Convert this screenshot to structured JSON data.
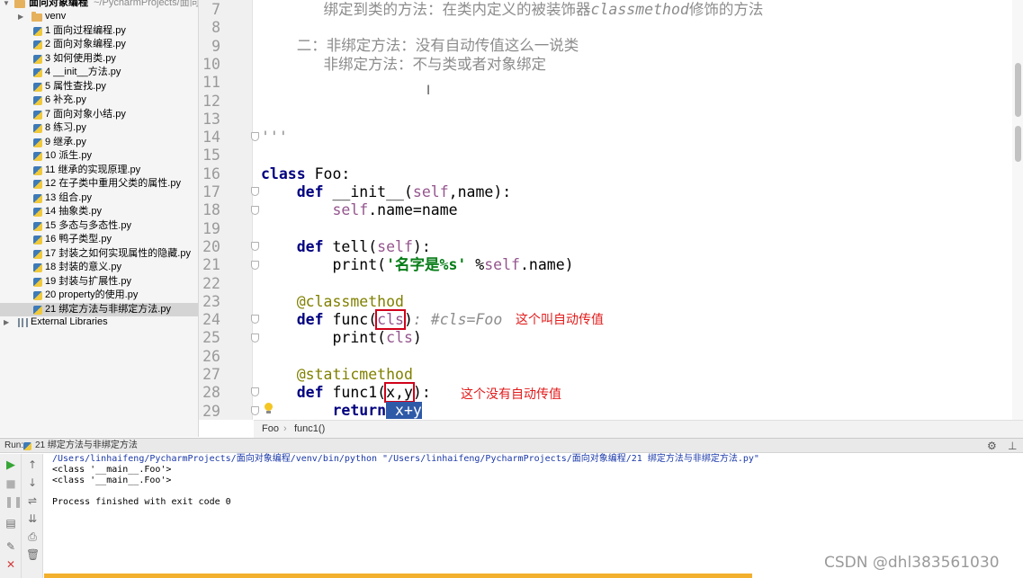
{
  "project": {
    "root_label": "面向对象编程",
    "root_path": "~/PycharmProjects/面向",
    "folder": "venv",
    "files": [
      "1 面向过程编程.py",
      "2 面向对象编程.py",
      "3 如何使用类.py",
      "4 __init__方法.py",
      "5 属性查找.py",
      "6 补充.py",
      "7 面向对象小结.py",
      "8 练习.py",
      "9 继承.py",
      "10 派生.py",
      "11 继承的实现原理.py",
      "12 在子类中重用父类的属性.py",
      "13 组合.py",
      "14 抽象类.py",
      "15 多态与多态性.py",
      "16 鸭子类型.py",
      "17 封装之如何实现属性的隐藏.py",
      "18 封装的意义.py",
      "19 封装与扩展性.py",
      "20 property的使用.py",
      "21 绑定方法与非绑定方法.py"
    ],
    "external_libraries": "External Libraries"
  },
  "editor": {
    "line_numbers": [
      "7",
      "8",
      "9",
      "10",
      "11",
      "12",
      "13",
      "14",
      "15",
      "16",
      "17",
      "18",
      "19",
      "20",
      "21",
      "22",
      "23",
      "24",
      "25",
      "26",
      "27",
      "28",
      "29"
    ],
    "line7": {
      "prefix": "       绑定到类的方法：在类内定义的被装饰器",
      "italic": "classmethod",
      "suffix": "修饰的方法"
    },
    "line9": "    二：非绑定方法：没有自动传值这么一说类",
    "line10": "       非绑定方法：不与类或者对象绑定",
    "line14": "'''",
    "line16": {
      "kw": "class",
      "rest": " Foo:"
    },
    "line17": {
      "kw": "def",
      "name": " __init__(",
      "self": "self",
      "rest": ",name):"
    },
    "line18": {
      "self": "self",
      "rest": ".name=name"
    },
    "line20": {
      "kw": "def",
      "name": " tell(",
      "self": "self",
      "rest": "):"
    },
    "line21": {
      "fn": "print(",
      "str": "'名字是%s'",
      "mid": " %",
      "self": "self",
      "rest": ".name)"
    },
    "line23": "@classmethod",
    "line24": {
      "kw": "def",
      "name": " func(",
      "boxed": "cls",
      "close": ")",
      "comment": ": #cls=Foo"
    },
    "line25": {
      "fn": "print(",
      "arg": "cls",
      "close": ")"
    },
    "line27": "@staticmethod",
    "line28": {
      "kw": "def",
      "name": " func1(",
      "boxed": "x,y",
      "close": ")",
      "colon": ":"
    },
    "line29": {
      "kw": "return",
      "selected": " x+y"
    },
    "annotation_auto": "这个叫自动传值",
    "annotation_no_auto": "这个没有自动传值"
  },
  "breadcrumb": {
    "class": "Foo",
    "sep": "›",
    "method": "func1()"
  },
  "run": {
    "label": "Run:",
    "tab": "21 绑定方法与非绑定方法",
    "console": [
      "/Users/linhaifeng/PycharmProjects/面向对象编程/venv/bin/python \"/Users/linhaifeng/PycharmProjects/面向对象编程/21 绑定方法与非绑定方法.py\"",
      "<class '__main__.Foo'>",
      "<class '__main__.Foo'>",
      "",
      "Process finished with exit code 0"
    ]
  },
  "watermark": "CSDN @dhl383561030",
  "colors": {
    "keyword": "#000080",
    "self": "#94558d",
    "string": "#067d17",
    "decorator": "#808000",
    "comment": "#8c8c8c",
    "annotation": "#e21b1b",
    "selection": "#2f5aa8"
  }
}
